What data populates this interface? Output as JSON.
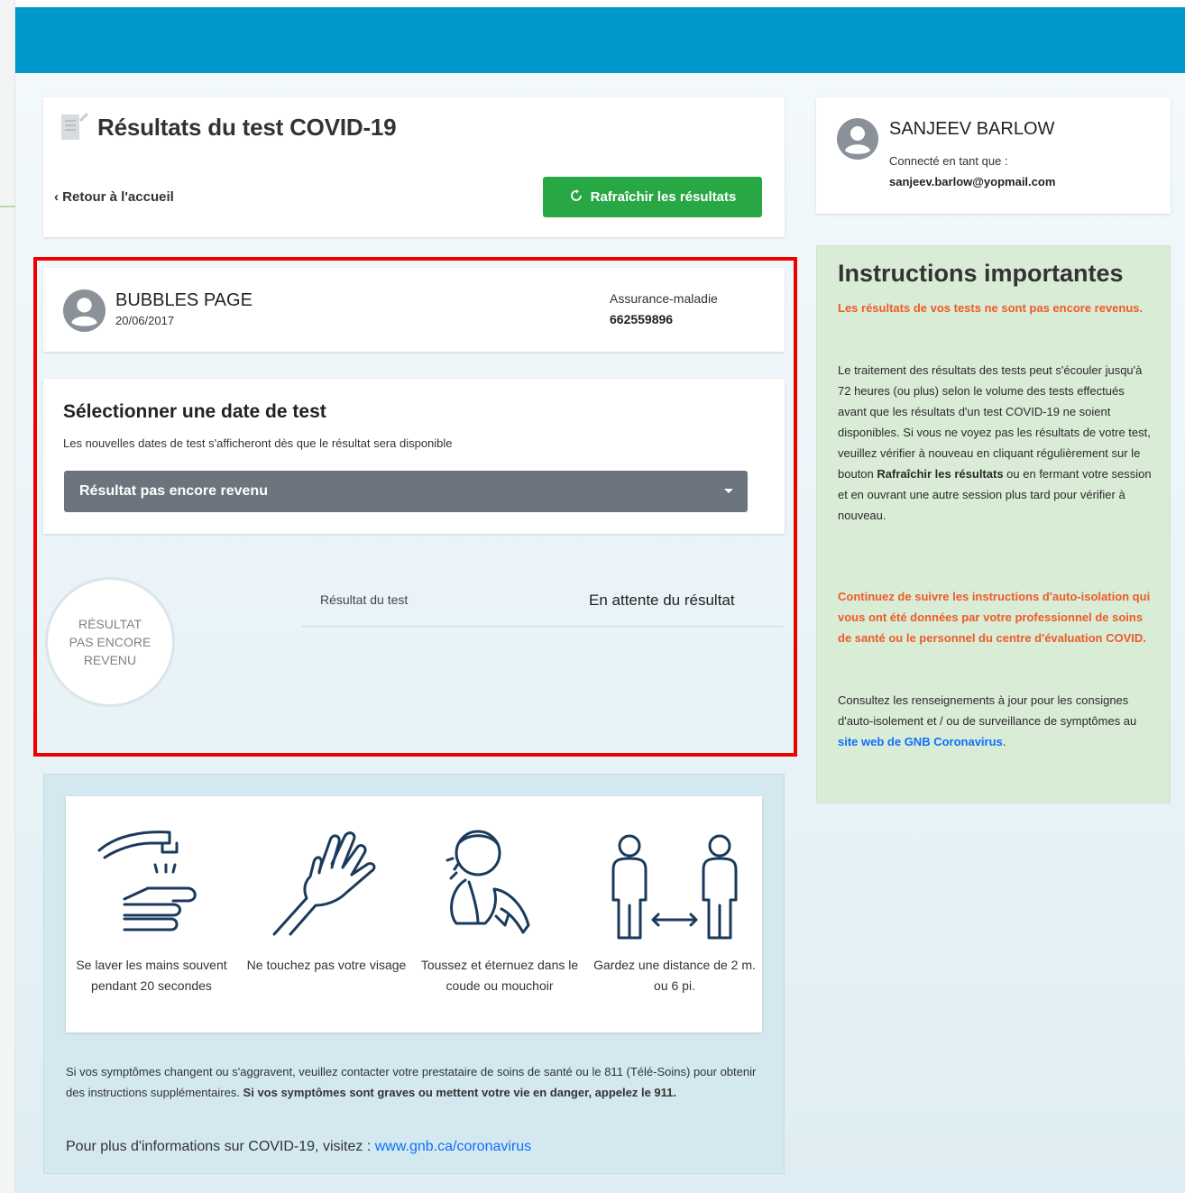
{
  "header": {
    "title": "Résultats du test COVID-19",
    "back_label": "Retour à l'accueil",
    "refresh_label": "Rafraîchir les résultats"
  },
  "user": {
    "name": "SANJEEV BARLOW",
    "connected_as": "Connecté en tant que :",
    "email": "sanjeev.barlow@yopmail.com"
  },
  "patient": {
    "name": "BUBBLES PAGE",
    "dob": "20/06/2017",
    "insurance_label": "Assurance-maladie",
    "insurance_number": "662559896"
  },
  "date_select": {
    "title": "Sélectionner une date de test",
    "description": "Les nouvelles dates de test s'afficheront dès que le résultat sera disponible",
    "selected": "Résultat pas encore revenu"
  },
  "result": {
    "circle_lines": [
      "RÉSULTAT",
      "PAS ENCORE",
      "REVENU"
    ],
    "label": "Résultat du test",
    "status": "En attente du résultat"
  },
  "instructions": {
    "title": "Instructions importantes",
    "warning": "Les résultats de vos tests ne sont pas encore revenus.",
    "body_before": "Le traitement des résultats des tests peut s'écouler jusqu'à 72 heures (ou plus) selon le volume des tests effectués avant que les résultats d'un test COVID-19 ne soient disponibles. Si vous ne voyez pas les résultats de votre test, veuillez vérifier à nouveau en cliquant régulièrement sur le bouton ",
    "body_bold": "Rafraîchir les résultats",
    "body_after": " ou en fermant votre session et en ouvrant une autre session plus tard pour vérifier à nouveau.",
    "continue": "Continuez de suivre les instructions d'auto-isolation qui vous ont été données par votre professionnel de soins de santé ou le personnel du centre d'évaluation COVID.",
    "consult_before": "Consultez les renseignements à jour pour les consignes d'auto-isolement et / ou de surveillance de symptômes au ",
    "consult_link": "site web de GNB Coronavirus",
    "consult_after": "."
  },
  "tips": [
    {
      "icon": "hand-washing-icon",
      "label": "Se laver les mains souvent pendant 20 secondes"
    },
    {
      "icon": "no-face-touch-icon",
      "label": "Ne touchez pas votre visage"
    },
    {
      "icon": "cough-elbow-icon",
      "label": "Toussez et éternuez dans le coude ou mouchoir"
    },
    {
      "icon": "distance-icon",
      "label": "Gardez une distance de 2 m. ou 6 pi."
    }
  ],
  "advice": {
    "text": "Si vos symptômes changent ou s'aggravent, veuillez contacter votre prestataire de soins de santé ou le 811 (Télé-Soins) pour obtenir des instructions supplémentaires. ",
    "bold": "Si vos symptômes sont graves ou mettent votre vie en danger, appelez le 911."
  },
  "more_info": {
    "text": "Pour plus d'informations sur COVID-19, visitez : ",
    "link": "www.gnb.ca/coronavirus"
  },
  "colors": {
    "topbar": "#0099cc",
    "refresh_button": "#28a745",
    "select_bg": "#6c757d",
    "instructions_bg": "#d9ecd6",
    "warning_text": "#f05a28",
    "link": "#0d6efd",
    "highlight_border": "#ee0000"
  }
}
